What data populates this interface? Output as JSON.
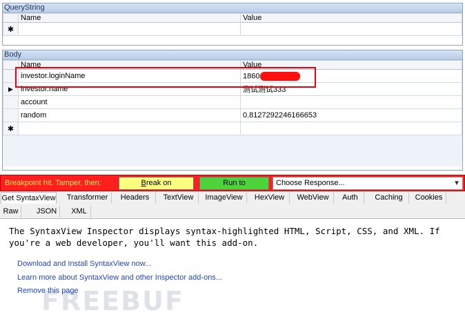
{
  "querystring": {
    "title": "QueryString",
    "col_name": "Name",
    "col_value": "Value",
    "new_row_marker": "✱"
  },
  "body": {
    "title": "Body",
    "col_name": "Name",
    "col_value": "Value",
    "rows": [
      {
        "name": "investor.loginName",
        "value": "1860",
        "redacted": true
      },
      {
        "name": "investor.name",
        "value": "测试测试333",
        "selected": true
      },
      {
        "name": "account",
        "value": ""
      },
      {
        "name": "random",
        "value": "0.8127292246166653"
      }
    ],
    "selected_marker": "▶",
    "new_row_marker": "✱"
  },
  "breakpoint": {
    "text": "Breakpoint hit. Tamper, then:",
    "break_label": "Break on Response",
    "run_label": "Run to Completion",
    "choose_placeholder": "Choose Response..."
  },
  "tabs": {
    "row1": [
      "Get SyntaxView",
      "Transformer",
      "Headers",
      "TextView",
      "ImageView",
      "HexView",
      "WebView",
      "Auth",
      "Caching",
      "Cookies"
    ],
    "row2": [
      "Raw",
      "JSON",
      "XML"
    ]
  },
  "content": {
    "description": "The SyntaxView Inspector displays syntax-highlighted HTML, Script, CSS, and XML. If you're a web developer, you'll want this add-on.",
    "link_download": "Download and Install SyntaxView now...",
    "link_learn": "Learn more about SyntaxView and other Inspector add-ons...",
    "link_remove": "Remove this page",
    "watermark": "FREEBUF"
  },
  "colors": {
    "breakpoint_bar": "#ff1f1f",
    "break_button": "#ffff80",
    "run_button": "#4cd43a",
    "link": "#1f46c8"
  }
}
